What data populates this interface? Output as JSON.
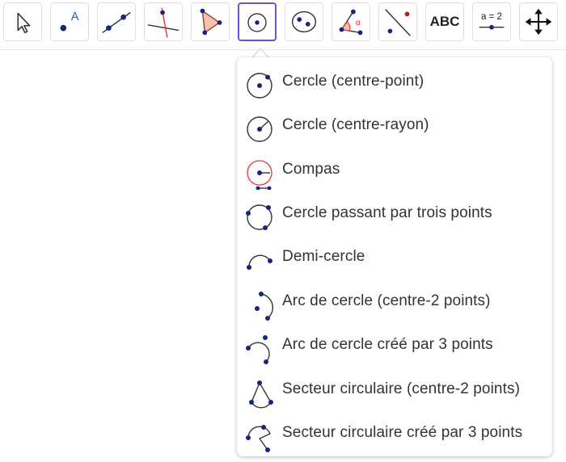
{
  "toolbar": {
    "tools": [
      {
        "name": "move-tool",
        "icon": "arrow-pointer-icon"
      },
      {
        "name": "point-tool",
        "icon": "point-a-icon",
        "glyph": "A"
      },
      {
        "name": "line-tool",
        "icon": "line-through-two-points-icon"
      },
      {
        "name": "perpendicular-line-tool",
        "icon": "perpendicular-line-icon"
      },
      {
        "name": "polygon-tool",
        "icon": "polygon-icon"
      },
      {
        "name": "circle-tool",
        "icon": "circle-center-point-icon",
        "active": true
      },
      {
        "name": "ellipse-tool",
        "icon": "ellipse-icon"
      },
      {
        "name": "angle-tool",
        "icon": "angle-icon",
        "glyph": "α"
      },
      {
        "name": "reflect-tool",
        "icon": "reflect-about-line-icon"
      },
      {
        "name": "text-tool",
        "icon": "text-icon",
        "label": "ABC"
      },
      {
        "name": "slider-tool",
        "icon": "slider-icon",
        "label": "a = 2"
      },
      {
        "name": "move-graphics-view-tool",
        "icon": "move-graphics-view-icon"
      }
    ]
  },
  "menu": {
    "items": [
      {
        "label": "Cercle (centre-point)",
        "icon": "circle-center-point-icon"
      },
      {
        "label": "Cercle (centre-rayon)",
        "icon": "circle-center-radius-icon"
      },
      {
        "label": "Compas",
        "icon": "compass-icon"
      },
      {
        "label": "Cercle passant par trois points",
        "icon": "circle-three-points-icon"
      },
      {
        "label": "Demi-cercle",
        "icon": "semicircle-icon"
      },
      {
        "label": "Arc de cercle (centre-2 points)",
        "icon": "arc-center-two-points-icon"
      },
      {
        "label": "Arc de cercle créé par 3 points",
        "icon": "arc-three-points-icon"
      },
      {
        "label": "Secteur circulaire (centre-2 points)",
        "icon": "sector-center-two-points-icon"
      },
      {
        "label": "Secteur circulaire créé par 3 points",
        "icon": "sector-three-points-icon"
      }
    ]
  },
  "colors": {
    "point": "#1a237e",
    "line": "#333333",
    "accent": "#6557d2",
    "red": "#e53935",
    "polygon_fill": "#f4c2ad",
    "label_blue": "#1565c0"
  }
}
